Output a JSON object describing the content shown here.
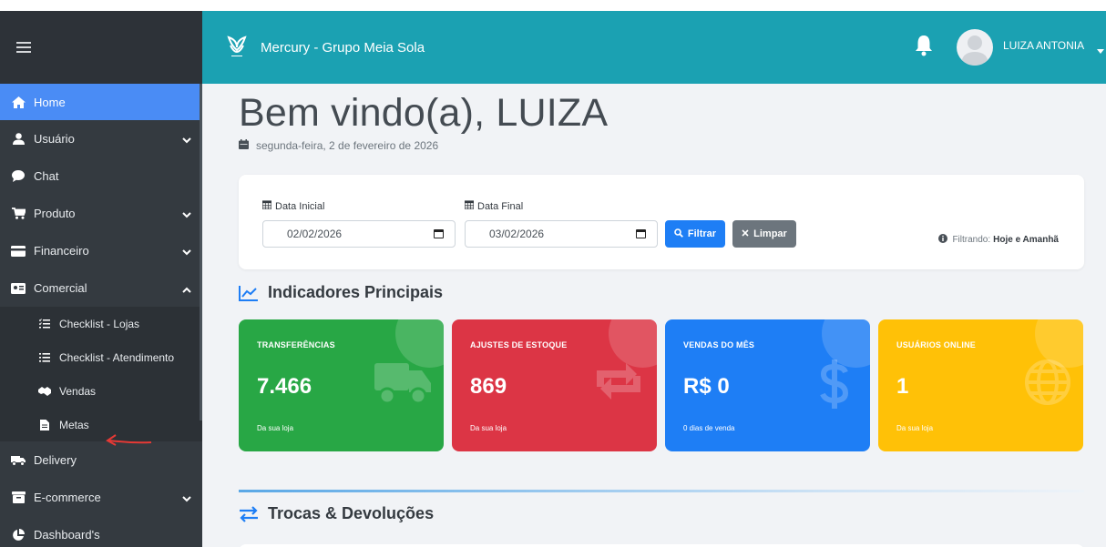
{
  "header": {
    "app_title": "Mercury - Grupo Meia Sola",
    "user_name": "LUIZA ANTONIA"
  },
  "sidebar": {
    "items": [
      {
        "label": "Home",
        "icon": "home-icon",
        "active": true
      },
      {
        "label": "Usuário",
        "icon": "user-icon",
        "expandable": true
      },
      {
        "label": "Chat",
        "icon": "chat-icon"
      },
      {
        "label": "Produto",
        "icon": "cart-icon",
        "expandable": true
      },
      {
        "label": "Financeiro",
        "icon": "card-icon",
        "expandable": true
      },
      {
        "label": "Comercial",
        "icon": "store-icon",
        "expandable": true,
        "expanded": true
      },
      {
        "label": "Delivery",
        "icon": "truck-icon"
      },
      {
        "label": "E-commerce",
        "icon": "ecommerce-icon",
        "expandable": true
      },
      {
        "label": "Dashboard's",
        "icon": "pie-chart-icon"
      }
    ],
    "comercial_submenu": [
      {
        "label": "Checklist - Lojas",
        "icon": "list-check-icon"
      },
      {
        "label": "Checklist - Atendimento",
        "icon": "list-icon"
      },
      {
        "label": "Vendas",
        "icon": "handshake-icon"
      },
      {
        "label": "Metas",
        "icon": "file-icon"
      }
    ]
  },
  "main": {
    "welcome": "Bem vindo(a), LUIZA",
    "date": "segunda-feira, 2 de fevereiro de 2026",
    "filter": {
      "start_label": "Data Inicial",
      "start_value": "02/02/2026",
      "end_label": "Data Final",
      "end_value": "03/02/2026",
      "filter_button": "Filtrar",
      "clear_button": "Limpar",
      "filtering_prefix": "Filtrando:",
      "filtering_value": "Hoje e Amanhã"
    },
    "indicators_title": "Indicadores Principais",
    "cards": [
      {
        "label": "TRANSFERÊNCIAS",
        "value": "7.466",
        "sub": "Da sua loja",
        "color": "#28a745",
        "icon": "truck-icon"
      },
      {
        "label": "AJUSTES DE ESTOQUE",
        "value": "869",
        "sub": "Da sua loja",
        "color": "#dc3545",
        "icon": "exchange-icon"
      },
      {
        "label": "VENDAS DO MÊS",
        "value": "R$ 0",
        "sub": "0 dias de venda",
        "color": "#1e7ef5",
        "icon": "dollar-icon"
      },
      {
        "label": "USUÁRIOS ONLINE",
        "value": "1",
        "sub": "Da sua loja",
        "color": "#ffc107",
        "icon": "globe-icon"
      }
    ],
    "returns_title": "Trocas & Devoluções"
  },
  "colors": {
    "topbar": "#1ba1b2",
    "sidebar": "#343a40",
    "active": "#4a8cf5",
    "annotation_arrow": "#e53935"
  }
}
